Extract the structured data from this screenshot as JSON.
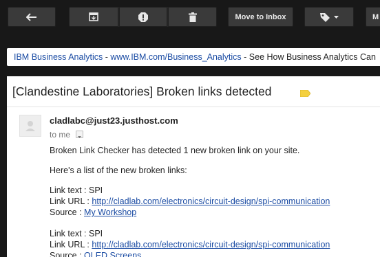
{
  "toolbar": {
    "back_icon": "arrow-left-icon",
    "archive_icon": "archive-icon",
    "spam_icon": "report-spam-icon",
    "delete_icon": "trash-icon",
    "move_label": "Move to Inbox",
    "labels_icon": "label-tag-icon",
    "more_label": "M"
  },
  "ad": {
    "sponsor": "IBM Business Analytics",
    "sep1": " - ",
    "url": "www.IBM.com/Business_Analytics",
    "sep2": " - ",
    "text": "See How Business Analytics Can"
  },
  "message": {
    "subject": "[Clandestine Laboratories] Broken links detected",
    "label_color": "#f4d03f",
    "sender": "cladlabc@just23.justhost.com",
    "to": "to me",
    "line1": "Broken Link Checker has detected 1 new broken link on your site.",
    "line2": "Here's a list of the new broken links:",
    "links": [
      {
        "text_label": "Link text : ",
        "text_value": "SPI",
        "url_label": "Link URL : ",
        "url_value": "http://cladlab.com/electronics/circuit-design/spi-communication",
        "source_label": "Source : ",
        "source_value": "My Workshop"
      },
      {
        "text_label": "Link text : ",
        "text_value": "SPI",
        "url_label": "Link URL : ",
        "url_value": "http://cladlab.com/electronics/circuit-design/spi-communication",
        "source_label": "Source : ",
        "source_value": "OLED Screens"
      }
    ]
  },
  "colors": {
    "background": "#181818",
    "button": "#3a3a3a",
    "link": "#1a4ba3"
  }
}
